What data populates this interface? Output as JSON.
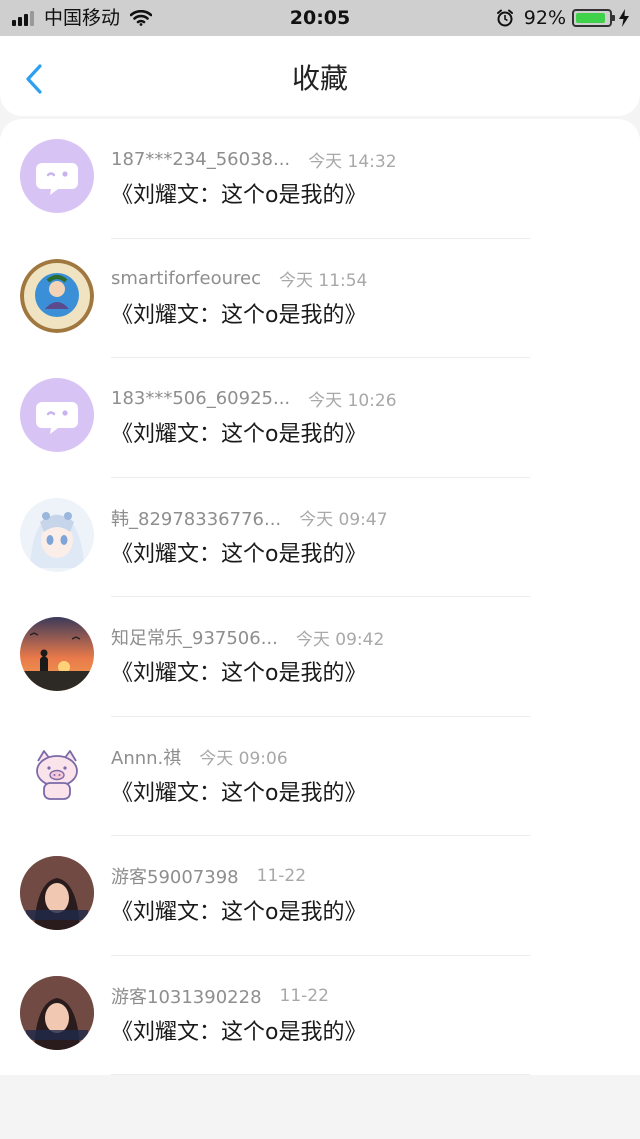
{
  "status_bar": {
    "carrier": "中国移动",
    "time": "20:05",
    "battery_percent": "92%",
    "battery_level": 0.92,
    "battery_color": "#3fd14a"
  },
  "header": {
    "title": "收藏",
    "back_icon": "chevron-left-icon",
    "accent_color": "#2b9ff2"
  },
  "favorites": [
    {
      "username": "187***234_56038...",
      "time": "今天 14:32",
      "text": "《刘耀文：这个o是我的》",
      "avatar": "default-chat-avatar"
    },
    {
      "username": "smartiforfeourec",
      "time": "今天 11:54",
      "text": "《刘耀文：这个o是我的》",
      "avatar": "illustration-avatar"
    },
    {
      "username": "183***506_60925...",
      "time": "今天 10:26",
      "text": "《刘耀文：这个o是我的》",
      "avatar": "default-chat-avatar"
    },
    {
      "username": "韩_82978336776...",
      "time": "今天 09:47",
      "text": "《刘耀文：这个o是我的》",
      "avatar": "anime-girl-avatar"
    },
    {
      "username": "知足常乐_937506...",
      "time": "今天 09:42",
      "text": "《刘耀文：这个o是我的》",
      "avatar": "sunset-avatar"
    },
    {
      "username": "Annn.祺",
      "time": "今天 09:06",
      "text": "《刘耀文：这个o是我的》",
      "avatar": "pig-avatar"
    },
    {
      "username": "游客59007398",
      "time": "11-22",
      "text": "《刘耀文：这个o是我的》",
      "avatar": "photo-avatar"
    },
    {
      "username": "游客1031390228",
      "time": "11-22",
      "text": "《刘耀文：这个o是我的》",
      "avatar": "photo-avatar"
    }
  ]
}
